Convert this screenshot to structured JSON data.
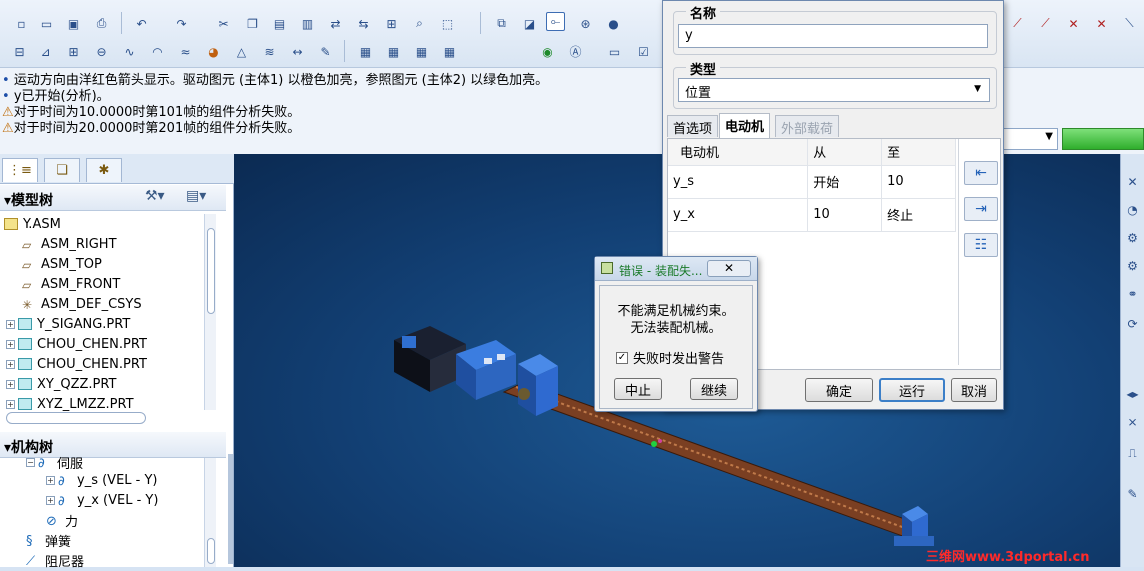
{
  "messages": [
    {
      "bullet": "•",
      "text": "运动方向由洋红色箭头显示。驱动图元 (主体1) 以橙色加亮，参照图元 (主体2) 以绿色加亮。",
      "type": "info"
    },
    {
      "bullet": "•",
      "text": "y已开始(分析)。",
      "type": "info"
    },
    {
      "bullet": "⚠",
      "text": "对于时间为10.0000时第101帧的组件分析失败。",
      "type": "warn"
    },
    {
      "bullet": "⚠",
      "text": "对于时间为20.0000时第201帧的组件分析失败。",
      "type": "warn"
    }
  ],
  "left_tabs": [
    "tree-tab",
    "layers-tab",
    "favorites-tab"
  ],
  "model_tree": {
    "title": "模型树",
    "items": [
      {
        "label": "Y.ASM",
        "icon": "assembly-icon",
        "level": 0
      },
      {
        "label": "ASM_RIGHT",
        "icon": "datum-plane-icon",
        "level": 1
      },
      {
        "label": "ASM_TOP",
        "icon": "datum-plane-icon",
        "level": 1
      },
      {
        "label": "ASM_FRONT",
        "icon": "datum-plane-icon",
        "level": 1
      },
      {
        "label": "ASM_DEF_CSYS",
        "icon": "csys-icon",
        "level": 1
      },
      {
        "label": "Y_SIGANG.PRT",
        "icon": "part-icon",
        "level": 1,
        "expand": true
      },
      {
        "label": "CHOU_CHEN.PRT",
        "icon": "part-icon",
        "level": 1,
        "expand": true
      },
      {
        "label": "CHOU_CHEN.PRT",
        "icon": "part-icon",
        "level": 1,
        "expand": true
      },
      {
        "label": "XY_QZZ.PRT",
        "icon": "part-icon",
        "level": 1,
        "expand": true
      },
      {
        "label": "XYZ_LMZZ.PRT",
        "icon": "part-icon",
        "level": 1,
        "expand": true
      }
    ]
  },
  "mech_tree": {
    "title": "机构树",
    "items": [
      {
        "label": "伺服",
        "level": 1
      },
      {
        "label": "y_s (VEL - Y)",
        "level": 2
      },
      {
        "label": "y_x (VEL - Y)",
        "level": 2
      },
      {
        "label": "力",
        "level": 1
      },
      {
        "label": "弹簧",
        "level": 0
      },
      {
        "label": "阻尼器",
        "level": 0
      }
    ]
  },
  "analysis_dialog": {
    "name_label": "名称",
    "name_value": "y",
    "type_label": "类型",
    "type_value": "位置",
    "tabs": [
      "首选项",
      "电动机",
      "外部载荷"
    ],
    "active_tab": 1,
    "table_headers": [
      "电动机",
      "从",
      "至"
    ],
    "table_rows": [
      [
        "y_s",
        "开始",
        "10"
      ],
      [
        "y_x",
        "10",
        "终止"
      ]
    ],
    "buttons": {
      "ok": "确定",
      "run": "运行",
      "cancel": "取消"
    }
  },
  "error_dialog": {
    "title": "错误 - 装配失...",
    "message_line1": "不能满足机械约束。",
    "message_line2": "无法装配机械。",
    "checkbox_label": "失败时发出警告",
    "checkbox_checked": true,
    "abort": "中止",
    "continue": "继续"
  },
  "watermark": "三维网www.3dportal.cn",
  "colors": {
    "accent": "#1d4ea8",
    "viewport": "#123f73",
    "screw": "#8a4a2a",
    "bracket": "#2f6fd0"
  }
}
